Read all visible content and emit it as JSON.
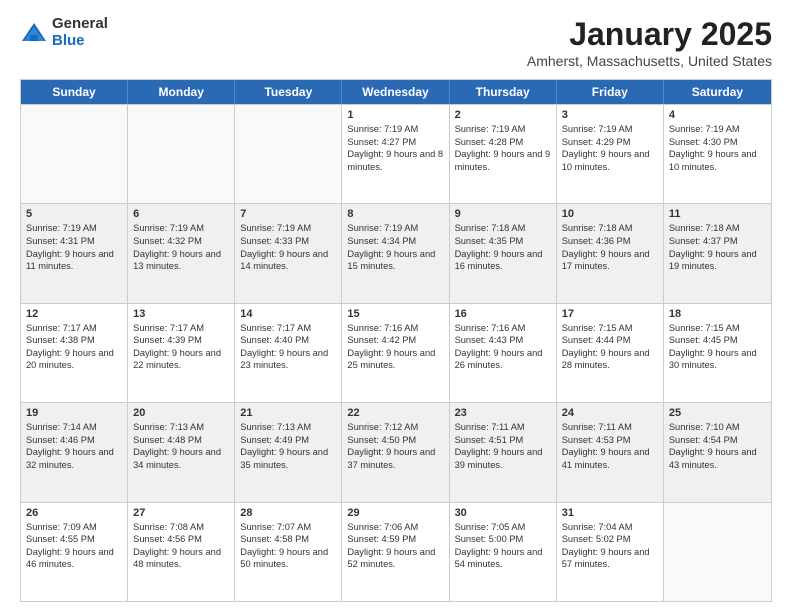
{
  "logo": {
    "general": "General",
    "blue": "Blue"
  },
  "header": {
    "month": "January 2025",
    "location": "Amherst, Massachusetts, United States"
  },
  "days_of_week": [
    "Sunday",
    "Monday",
    "Tuesday",
    "Wednesday",
    "Thursday",
    "Friday",
    "Saturday"
  ],
  "weeks": [
    [
      {
        "day": "",
        "sunrise": "",
        "sunset": "",
        "daylight": "",
        "shaded": false,
        "empty": true
      },
      {
        "day": "",
        "sunrise": "",
        "sunset": "",
        "daylight": "",
        "shaded": false,
        "empty": true
      },
      {
        "day": "",
        "sunrise": "",
        "sunset": "",
        "daylight": "",
        "shaded": false,
        "empty": true
      },
      {
        "day": "1",
        "sunrise": "Sunrise: 7:19 AM",
        "sunset": "Sunset: 4:27 PM",
        "daylight": "Daylight: 9 hours and 8 minutes.",
        "shaded": false,
        "empty": false
      },
      {
        "day": "2",
        "sunrise": "Sunrise: 7:19 AM",
        "sunset": "Sunset: 4:28 PM",
        "daylight": "Daylight: 9 hours and 9 minutes.",
        "shaded": false,
        "empty": false
      },
      {
        "day": "3",
        "sunrise": "Sunrise: 7:19 AM",
        "sunset": "Sunset: 4:29 PM",
        "daylight": "Daylight: 9 hours and 10 minutes.",
        "shaded": false,
        "empty": false
      },
      {
        "day": "4",
        "sunrise": "Sunrise: 7:19 AM",
        "sunset": "Sunset: 4:30 PM",
        "daylight": "Daylight: 9 hours and 10 minutes.",
        "shaded": false,
        "empty": false
      }
    ],
    [
      {
        "day": "5",
        "sunrise": "Sunrise: 7:19 AM",
        "sunset": "Sunset: 4:31 PM",
        "daylight": "Daylight: 9 hours and 11 minutes.",
        "shaded": true,
        "empty": false
      },
      {
        "day": "6",
        "sunrise": "Sunrise: 7:19 AM",
        "sunset": "Sunset: 4:32 PM",
        "daylight": "Daylight: 9 hours and 13 minutes.",
        "shaded": true,
        "empty": false
      },
      {
        "day": "7",
        "sunrise": "Sunrise: 7:19 AM",
        "sunset": "Sunset: 4:33 PM",
        "daylight": "Daylight: 9 hours and 14 minutes.",
        "shaded": true,
        "empty": false
      },
      {
        "day": "8",
        "sunrise": "Sunrise: 7:19 AM",
        "sunset": "Sunset: 4:34 PM",
        "daylight": "Daylight: 9 hours and 15 minutes.",
        "shaded": true,
        "empty": false
      },
      {
        "day": "9",
        "sunrise": "Sunrise: 7:18 AM",
        "sunset": "Sunset: 4:35 PM",
        "daylight": "Daylight: 9 hours and 16 minutes.",
        "shaded": true,
        "empty": false
      },
      {
        "day": "10",
        "sunrise": "Sunrise: 7:18 AM",
        "sunset": "Sunset: 4:36 PM",
        "daylight": "Daylight: 9 hours and 17 minutes.",
        "shaded": true,
        "empty": false
      },
      {
        "day": "11",
        "sunrise": "Sunrise: 7:18 AM",
        "sunset": "Sunset: 4:37 PM",
        "daylight": "Daylight: 9 hours and 19 minutes.",
        "shaded": true,
        "empty": false
      }
    ],
    [
      {
        "day": "12",
        "sunrise": "Sunrise: 7:17 AM",
        "sunset": "Sunset: 4:38 PM",
        "daylight": "Daylight: 9 hours and 20 minutes.",
        "shaded": false,
        "empty": false
      },
      {
        "day": "13",
        "sunrise": "Sunrise: 7:17 AM",
        "sunset": "Sunset: 4:39 PM",
        "daylight": "Daylight: 9 hours and 22 minutes.",
        "shaded": false,
        "empty": false
      },
      {
        "day": "14",
        "sunrise": "Sunrise: 7:17 AM",
        "sunset": "Sunset: 4:40 PM",
        "daylight": "Daylight: 9 hours and 23 minutes.",
        "shaded": false,
        "empty": false
      },
      {
        "day": "15",
        "sunrise": "Sunrise: 7:16 AM",
        "sunset": "Sunset: 4:42 PM",
        "daylight": "Daylight: 9 hours and 25 minutes.",
        "shaded": false,
        "empty": false
      },
      {
        "day": "16",
        "sunrise": "Sunrise: 7:16 AM",
        "sunset": "Sunset: 4:43 PM",
        "daylight": "Daylight: 9 hours and 26 minutes.",
        "shaded": false,
        "empty": false
      },
      {
        "day": "17",
        "sunrise": "Sunrise: 7:15 AM",
        "sunset": "Sunset: 4:44 PM",
        "daylight": "Daylight: 9 hours and 28 minutes.",
        "shaded": false,
        "empty": false
      },
      {
        "day": "18",
        "sunrise": "Sunrise: 7:15 AM",
        "sunset": "Sunset: 4:45 PM",
        "daylight": "Daylight: 9 hours and 30 minutes.",
        "shaded": false,
        "empty": false
      }
    ],
    [
      {
        "day": "19",
        "sunrise": "Sunrise: 7:14 AM",
        "sunset": "Sunset: 4:46 PM",
        "daylight": "Daylight: 9 hours and 32 minutes.",
        "shaded": true,
        "empty": false
      },
      {
        "day": "20",
        "sunrise": "Sunrise: 7:13 AM",
        "sunset": "Sunset: 4:48 PM",
        "daylight": "Daylight: 9 hours and 34 minutes.",
        "shaded": true,
        "empty": false
      },
      {
        "day": "21",
        "sunrise": "Sunrise: 7:13 AM",
        "sunset": "Sunset: 4:49 PM",
        "daylight": "Daylight: 9 hours and 35 minutes.",
        "shaded": true,
        "empty": false
      },
      {
        "day": "22",
        "sunrise": "Sunrise: 7:12 AM",
        "sunset": "Sunset: 4:50 PM",
        "daylight": "Daylight: 9 hours and 37 minutes.",
        "shaded": true,
        "empty": false
      },
      {
        "day": "23",
        "sunrise": "Sunrise: 7:11 AM",
        "sunset": "Sunset: 4:51 PM",
        "daylight": "Daylight: 9 hours and 39 minutes.",
        "shaded": true,
        "empty": false
      },
      {
        "day": "24",
        "sunrise": "Sunrise: 7:11 AM",
        "sunset": "Sunset: 4:53 PM",
        "daylight": "Daylight: 9 hours and 41 minutes.",
        "shaded": true,
        "empty": false
      },
      {
        "day": "25",
        "sunrise": "Sunrise: 7:10 AM",
        "sunset": "Sunset: 4:54 PM",
        "daylight": "Daylight: 9 hours and 43 minutes.",
        "shaded": true,
        "empty": false
      }
    ],
    [
      {
        "day": "26",
        "sunrise": "Sunrise: 7:09 AM",
        "sunset": "Sunset: 4:55 PM",
        "daylight": "Daylight: 9 hours and 46 minutes.",
        "shaded": false,
        "empty": false
      },
      {
        "day": "27",
        "sunrise": "Sunrise: 7:08 AM",
        "sunset": "Sunset: 4:56 PM",
        "daylight": "Daylight: 9 hours and 48 minutes.",
        "shaded": false,
        "empty": false
      },
      {
        "day": "28",
        "sunrise": "Sunrise: 7:07 AM",
        "sunset": "Sunset: 4:58 PM",
        "daylight": "Daylight: 9 hours and 50 minutes.",
        "shaded": false,
        "empty": false
      },
      {
        "day": "29",
        "sunrise": "Sunrise: 7:06 AM",
        "sunset": "Sunset: 4:59 PM",
        "daylight": "Daylight: 9 hours and 52 minutes.",
        "shaded": false,
        "empty": false
      },
      {
        "day": "30",
        "sunrise": "Sunrise: 7:05 AM",
        "sunset": "Sunset: 5:00 PM",
        "daylight": "Daylight: 9 hours and 54 minutes.",
        "shaded": false,
        "empty": false
      },
      {
        "day": "31",
        "sunrise": "Sunrise: 7:04 AM",
        "sunset": "Sunset: 5:02 PM",
        "daylight": "Daylight: 9 hours and 57 minutes.",
        "shaded": false,
        "empty": false
      },
      {
        "day": "",
        "sunrise": "",
        "sunset": "",
        "daylight": "",
        "shaded": false,
        "empty": true
      }
    ]
  ]
}
